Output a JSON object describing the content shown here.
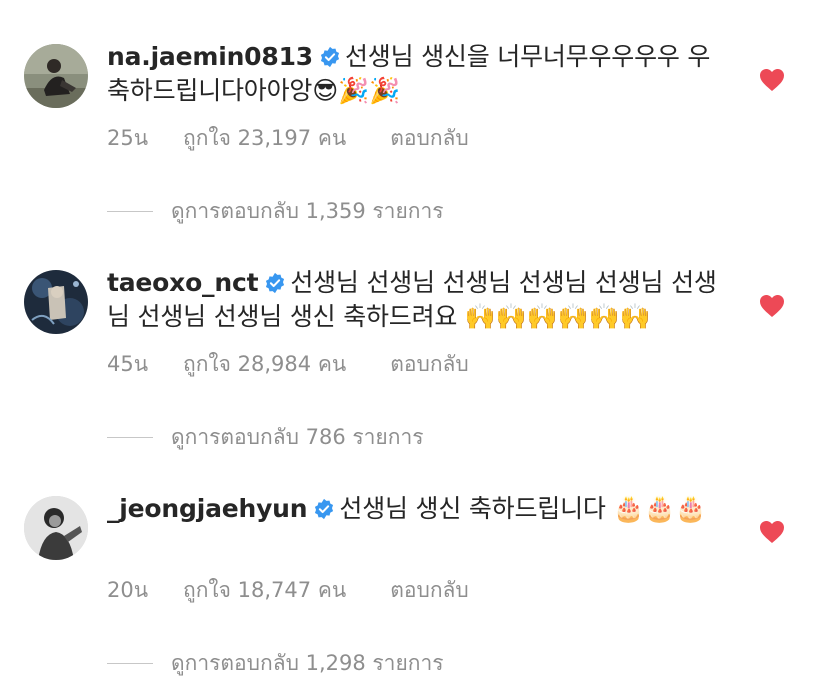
{
  "comments": [
    {
      "username": "na.jaemin0813",
      "text": "선생님 생신을 너무너무우우우우 우 축하드립니다아아앙😎🎉🎉",
      "time": "25น",
      "likes": "ถูกใจ 23,197 คน",
      "reply_label": "ตอบกลับ",
      "view_replies": "ดูการตอบกลับ 1,359 รายการ"
    },
    {
      "username": "taeoxo_nct",
      "text": "선생님 선생님 선생님 선생님 선생님 선생님 선생님 선생님 생신 축하드려요 🙌🙌🙌🙌🙌🙌",
      "time": "45น",
      "likes": "ถูกใจ 28,984 คน",
      "reply_label": "ตอบกลับ",
      "view_replies": "ดูการตอบกลับ 786 รายการ"
    },
    {
      "username": "_jeongjaehyun",
      "text": "선생님 생신 축하드립니다 🎂🎂🎂",
      "time": "20น",
      "likes": "ถูกใจ 18,747 คน",
      "reply_label": "ตอบกลับ",
      "view_replies": "ดูการตอบกลับ 1,298 รายการ"
    }
  ],
  "icons": {
    "verified": "verified-badge-icon",
    "like": "heart-icon"
  },
  "colors": {
    "heart": "#ed4956",
    "verified": "#3897f0",
    "secondary_text": "#8e8e8e",
    "primary_text": "#262626"
  }
}
